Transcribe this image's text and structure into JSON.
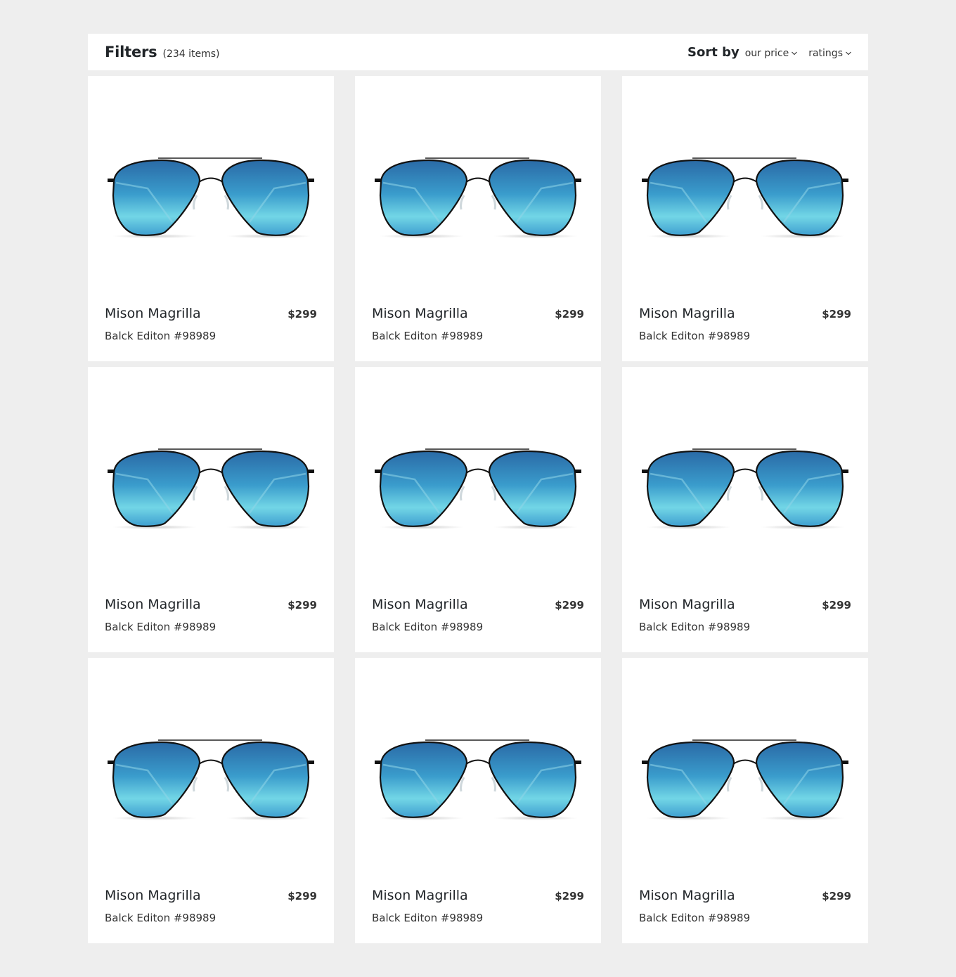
{
  "header": {
    "filters_label": "Filters",
    "item_count": "(234 items)",
    "sort_label": "Sort by",
    "sort_options": [
      {
        "label": "our price",
        "icon": "chevron-down-icon"
      },
      {
        "label": "ratings",
        "icon": "chevron-down-icon"
      }
    ]
  },
  "colors": {
    "background": "#eeeeee",
    "card": "#ffffff",
    "text": "#212529",
    "lens_top": "#2a6fa8",
    "lens_bottom": "#6fd6e4",
    "frame": "#111111"
  },
  "products": [
    {
      "name": "Mison Magrilla",
      "edition": "Balck Editon #98989",
      "price": "$299",
      "image": "aviator-sunglasses-blue"
    },
    {
      "name": "Mison Magrilla",
      "edition": "Balck Editon #98989",
      "price": "$299",
      "image": "aviator-sunglasses-blue"
    },
    {
      "name": "Mison Magrilla",
      "edition": "Balck Editon #98989",
      "price": "$299",
      "image": "aviator-sunglasses-blue"
    },
    {
      "name": "Mison Magrilla",
      "edition": "Balck Editon #98989",
      "price": "$299",
      "image": "aviator-sunglasses-blue"
    },
    {
      "name": "Mison Magrilla",
      "edition": "Balck Editon #98989",
      "price": "$299",
      "image": "aviator-sunglasses-blue"
    },
    {
      "name": "Mison Magrilla",
      "edition": "Balck Editon #98989",
      "price": "$299",
      "image": "aviator-sunglasses-blue"
    },
    {
      "name": "Mison Magrilla",
      "edition": "Balck Editon #98989",
      "price": "$299",
      "image": "aviator-sunglasses-blue"
    },
    {
      "name": "Mison Magrilla",
      "edition": "Balck Editon #98989",
      "price": "$299",
      "image": "aviator-sunglasses-blue"
    },
    {
      "name": "Mison Magrilla",
      "edition": "Balck Editon #98989",
      "price": "$299",
      "image": "aviator-sunglasses-blue"
    }
  ]
}
